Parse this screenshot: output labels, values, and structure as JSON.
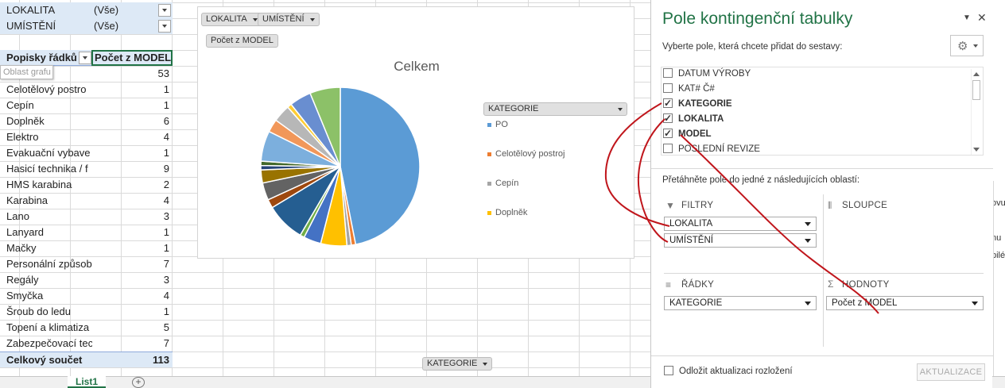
{
  "sheet": {
    "filters": [
      {
        "field": "LOKALITA",
        "value": "(Vše)"
      },
      {
        "field": "UMÍSTĚNÍ",
        "value": "(Vše)"
      }
    ],
    "row_labels_header": "Popisky řádků",
    "value_header": "Počet z MODEL",
    "tooltip": "Oblast grafu",
    "rows": [
      {
        "label": "PO",
        "count": "53"
      },
      {
        "label": "Celotělový postro",
        "count": "1"
      },
      {
        "label": "Cepín",
        "count": "1"
      },
      {
        "label": "Doplněk",
        "count": "6"
      },
      {
        "label": "Elektro",
        "count": "4"
      },
      {
        "label": "Evakuační vybave",
        "count": "1"
      },
      {
        "label": "Hasicí technika / f",
        "count": "9"
      },
      {
        "label": "HMS karabina",
        "count": "2"
      },
      {
        "label": "Karabina",
        "count": "4"
      },
      {
        "label": "Lano",
        "count": "3"
      },
      {
        "label": "Lanyard",
        "count": "1"
      },
      {
        "label": "Mačky",
        "count": "1"
      },
      {
        "label": "Personální způsob",
        "count": "7"
      },
      {
        "label": "Regály",
        "count": "3"
      },
      {
        "label": "Smyčka",
        "count": "4"
      },
      {
        "label": "Šroub do ledu",
        "count": "1"
      },
      {
        "label": "Topení a klimatiza",
        "count": "5"
      },
      {
        "label": "Zabezpečovací tec",
        "count": "7"
      }
    ],
    "total_label": "Celkový součet",
    "total_value": "113"
  },
  "chart": {
    "filter_buttons": [
      "LOKALITA",
      "UMÍSTĚNÍ"
    ],
    "value_button": "Počet z MODEL",
    "title": "Celkem",
    "legend_header": "KATEGORIE",
    "legend": [
      {
        "label": "PO",
        "color": "#5b9bd5"
      },
      {
        "label": "Celotělový postroj",
        "color": "#ed7d31"
      },
      {
        "label": "Cepín",
        "color": "#a5a5a5"
      },
      {
        "label": "Doplněk",
        "color": "#ffc000"
      }
    ],
    "axis_button": "KATEGORIE"
  },
  "chart_data": {
    "type": "pie",
    "title": "Celkem",
    "categories": [
      "PO",
      "Celotělový postroj",
      "Cepín",
      "Doplněk",
      "Elektro",
      "Evakuační vybave",
      "Hasicí technika / f",
      "HMS karabina",
      "Karabina",
      "Lano",
      "Lanyard",
      "Mačky",
      "Personální způsob",
      "Regály",
      "Smyčka",
      "Šroub do ledu",
      "Topení a klimatiza",
      "Zabezpečovací tec"
    ],
    "values": [
      53,
      1,
      1,
      6,
      4,
      1,
      9,
      2,
      4,
      3,
      1,
      1,
      7,
      3,
      4,
      1,
      5,
      7
    ],
    "colors": [
      "#5b9bd5",
      "#ed7d31",
      "#a5a5a5",
      "#ffc000",
      "#4472c4",
      "#70ad47",
      "#255e91",
      "#9e480e",
      "#636363",
      "#997300",
      "#264478",
      "#43682b",
      "#7cafdd",
      "#f1975a",
      "#b7b7b7",
      "#ffcd33",
      "#698ed0",
      "#8cc168"
    ],
    "legend_placement": "right"
  },
  "tabs": {
    "active": "List1",
    "add_icon": "plus-circle-icon"
  },
  "pane": {
    "title": "Pole kontingenční tabulky",
    "subtitle": "Vyberte pole, která chcete přidat do sestavy:",
    "fields": [
      {
        "name": "DATUM VÝROBY",
        "checked": false
      },
      {
        "name": "KAT# Č#",
        "checked": false
      },
      {
        "name": "KATEGORIE",
        "checked": true
      },
      {
        "name": "LOKALITA",
        "checked": true
      },
      {
        "name": "MODEL",
        "checked": true
      },
      {
        "name": "POSLEDNÍ REVIZE",
        "checked": false
      }
    ],
    "drag_hint": "Přetáhněte pole do jedné z následujících oblastí:",
    "areas": {
      "filters": {
        "title": "FILTRY",
        "items": [
          "LOKALITA",
          "UMÍSTĚNÍ"
        ]
      },
      "columns": {
        "title": "SLOUPCE",
        "items": []
      },
      "rows": {
        "title": "ŘÁDKY",
        "items": [
          "KATEGORIE"
        ]
      },
      "values": {
        "title": "HODNOTY",
        "items": [
          "Počet z MODEL"
        ]
      }
    },
    "defer_label": "Odložit aktualizaci rozložení",
    "update_label": "AKTUALIZACE",
    "annotation_color": "#c0161c"
  },
  "edge_texts": [
    "ovu",
    "nu",
    "pilé"
  ]
}
